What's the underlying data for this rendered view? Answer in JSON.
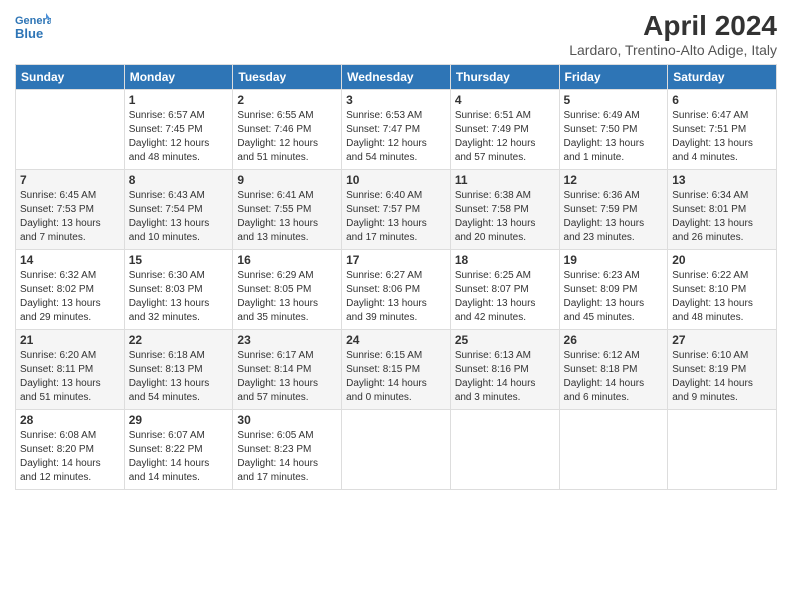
{
  "header": {
    "logo_line1": "General",
    "logo_line2": "Blue",
    "month_title": "April 2024",
    "location": "Lardaro, Trentino-Alto Adige, Italy"
  },
  "days_of_week": [
    "Sunday",
    "Monday",
    "Tuesday",
    "Wednesday",
    "Thursday",
    "Friday",
    "Saturday"
  ],
  "weeks": [
    [
      {
        "day": "",
        "info": ""
      },
      {
        "day": "1",
        "info": "Sunrise: 6:57 AM\nSunset: 7:45 PM\nDaylight: 12 hours\nand 48 minutes."
      },
      {
        "day": "2",
        "info": "Sunrise: 6:55 AM\nSunset: 7:46 PM\nDaylight: 12 hours\nand 51 minutes."
      },
      {
        "day": "3",
        "info": "Sunrise: 6:53 AM\nSunset: 7:47 PM\nDaylight: 12 hours\nand 54 minutes."
      },
      {
        "day": "4",
        "info": "Sunrise: 6:51 AM\nSunset: 7:49 PM\nDaylight: 12 hours\nand 57 minutes."
      },
      {
        "day": "5",
        "info": "Sunrise: 6:49 AM\nSunset: 7:50 PM\nDaylight: 13 hours\nand 1 minute."
      },
      {
        "day": "6",
        "info": "Sunrise: 6:47 AM\nSunset: 7:51 PM\nDaylight: 13 hours\nand 4 minutes."
      }
    ],
    [
      {
        "day": "7",
        "info": "Sunrise: 6:45 AM\nSunset: 7:53 PM\nDaylight: 13 hours\nand 7 minutes."
      },
      {
        "day": "8",
        "info": "Sunrise: 6:43 AM\nSunset: 7:54 PM\nDaylight: 13 hours\nand 10 minutes."
      },
      {
        "day": "9",
        "info": "Sunrise: 6:41 AM\nSunset: 7:55 PM\nDaylight: 13 hours\nand 13 minutes."
      },
      {
        "day": "10",
        "info": "Sunrise: 6:40 AM\nSunset: 7:57 PM\nDaylight: 13 hours\nand 17 minutes."
      },
      {
        "day": "11",
        "info": "Sunrise: 6:38 AM\nSunset: 7:58 PM\nDaylight: 13 hours\nand 20 minutes."
      },
      {
        "day": "12",
        "info": "Sunrise: 6:36 AM\nSunset: 7:59 PM\nDaylight: 13 hours\nand 23 minutes."
      },
      {
        "day": "13",
        "info": "Sunrise: 6:34 AM\nSunset: 8:01 PM\nDaylight: 13 hours\nand 26 minutes."
      }
    ],
    [
      {
        "day": "14",
        "info": "Sunrise: 6:32 AM\nSunset: 8:02 PM\nDaylight: 13 hours\nand 29 minutes."
      },
      {
        "day": "15",
        "info": "Sunrise: 6:30 AM\nSunset: 8:03 PM\nDaylight: 13 hours\nand 32 minutes."
      },
      {
        "day": "16",
        "info": "Sunrise: 6:29 AM\nSunset: 8:05 PM\nDaylight: 13 hours\nand 35 minutes."
      },
      {
        "day": "17",
        "info": "Sunrise: 6:27 AM\nSunset: 8:06 PM\nDaylight: 13 hours\nand 39 minutes."
      },
      {
        "day": "18",
        "info": "Sunrise: 6:25 AM\nSunset: 8:07 PM\nDaylight: 13 hours\nand 42 minutes."
      },
      {
        "day": "19",
        "info": "Sunrise: 6:23 AM\nSunset: 8:09 PM\nDaylight: 13 hours\nand 45 minutes."
      },
      {
        "day": "20",
        "info": "Sunrise: 6:22 AM\nSunset: 8:10 PM\nDaylight: 13 hours\nand 48 minutes."
      }
    ],
    [
      {
        "day": "21",
        "info": "Sunrise: 6:20 AM\nSunset: 8:11 PM\nDaylight: 13 hours\nand 51 minutes."
      },
      {
        "day": "22",
        "info": "Sunrise: 6:18 AM\nSunset: 8:13 PM\nDaylight: 13 hours\nand 54 minutes."
      },
      {
        "day": "23",
        "info": "Sunrise: 6:17 AM\nSunset: 8:14 PM\nDaylight: 13 hours\nand 57 minutes."
      },
      {
        "day": "24",
        "info": "Sunrise: 6:15 AM\nSunset: 8:15 PM\nDaylight: 14 hours\nand 0 minutes."
      },
      {
        "day": "25",
        "info": "Sunrise: 6:13 AM\nSunset: 8:16 PM\nDaylight: 14 hours\nand 3 minutes."
      },
      {
        "day": "26",
        "info": "Sunrise: 6:12 AM\nSunset: 8:18 PM\nDaylight: 14 hours\nand 6 minutes."
      },
      {
        "day": "27",
        "info": "Sunrise: 6:10 AM\nSunset: 8:19 PM\nDaylight: 14 hours\nand 9 minutes."
      }
    ],
    [
      {
        "day": "28",
        "info": "Sunrise: 6:08 AM\nSunset: 8:20 PM\nDaylight: 14 hours\nand 12 minutes."
      },
      {
        "day": "29",
        "info": "Sunrise: 6:07 AM\nSunset: 8:22 PM\nDaylight: 14 hours\nand 14 minutes."
      },
      {
        "day": "30",
        "info": "Sunrise: 6:05 AM\nSunset: 8:23 PM\nDaylight: 14 hours\nand 17 minutes."
      },
      {
        "day": "",
        "info": ""
      },
      {
        "day": "",
        "info": ""
      },
      {
        "day": "",
        "info": ""
      },
      {
        "day": "",
        "info": ""
      }
    ]
  ]
}
